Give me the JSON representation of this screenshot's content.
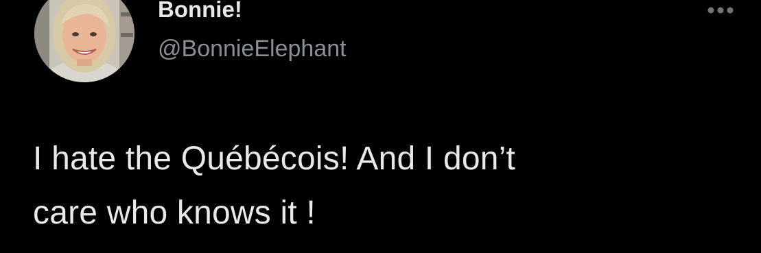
{
  "tweet": {
    "author": {
      "display_name": "Bonnie!",
      "handle": "@BonnieElephant",
      "avatar_icon": "profile-photo"
    },
    "more_icon": "more-horizontal-icon",
    "text_lines": [
      "I hate the Québécois! And I don’t",
      "care who knows it !"
    ]
  },
  "colors": {
    "background": "#000000",
    "primary_text": "#e7e9ea",
    "secondary_text": "#8b9096"
  }
}
